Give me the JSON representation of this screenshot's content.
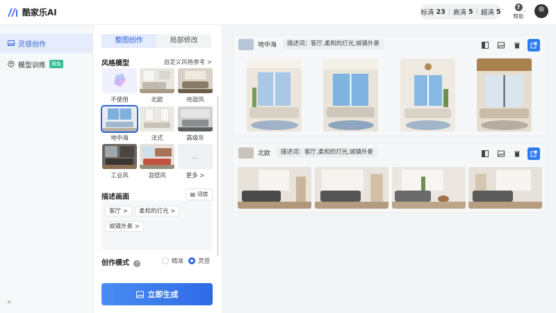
{
  "app": {
    "name": "酷家乐AI"
  },
  "header": {
    "quota": [
      {
        "label": "标清",
        "count": "23"
      },
      {
        "label": "高清",
        "count": "5"
      },
      {
        "label": "超清",
        "count": "5"
      }
    ],
    "help_label": "帮助"
  },
  "sidebar": {
    "items": [
      {
        "label": "灵感创作",
        "icon": "image-icon"
      },
      {
        "label": "模型训练",
        "icon": "upload-icon",
        "badge": "限免"
      }
    ],
    "collapse": "«"
  },
  "panel": {
    "tabs": [
      "整图创作",
      "局部修改"
    ],
    "style_section": {
      "title": "风格模型",
      "link": "自定义风格参考 >"
    },
    "styles": [
      {
        "label": "不使用"
      },
      {
        "label": "北欧"
      },
      {
        "label": "侘寂风"
      },
      {
        "label": "地中海"
      },
      {
        "label": "法式"
      },
      {
        "label": "高级灰"
      },
      {
        "label": "工业风"
      },
      {
        "label": "混搭风"
      },
      {
        "label": "更多 >",
        "glyph": "..."
      }
    ],
    "desc_section": {
      "title": "描述画面",
      "lexicon": "词库"
    },
    "chips": [
      "客厅 >",
      "柔和的灯光 >",
      "城镇外景 >"
    ],
    "mode": {
      "title": "创作模式",
      "options": [
        "精准",
        "灵感"
      ],
      "selected": "灵感"
    },
    "generate_label": "立即生成"
  },
  "results": [
    {
      "style": "地中海",
      "prompt": "描述词：客厅,柔和的灯光,城镇外景"
    },
    {
      "style": "北欧",
      "prompt": "描述词：客厅,柔和的灯光,城镇外景"
    }
  ],
  "colors": {
    "accent": "#2e62d9",
    "primary_button": "#2e7af0",
    "badge": "#2fbf91"
  }
}
